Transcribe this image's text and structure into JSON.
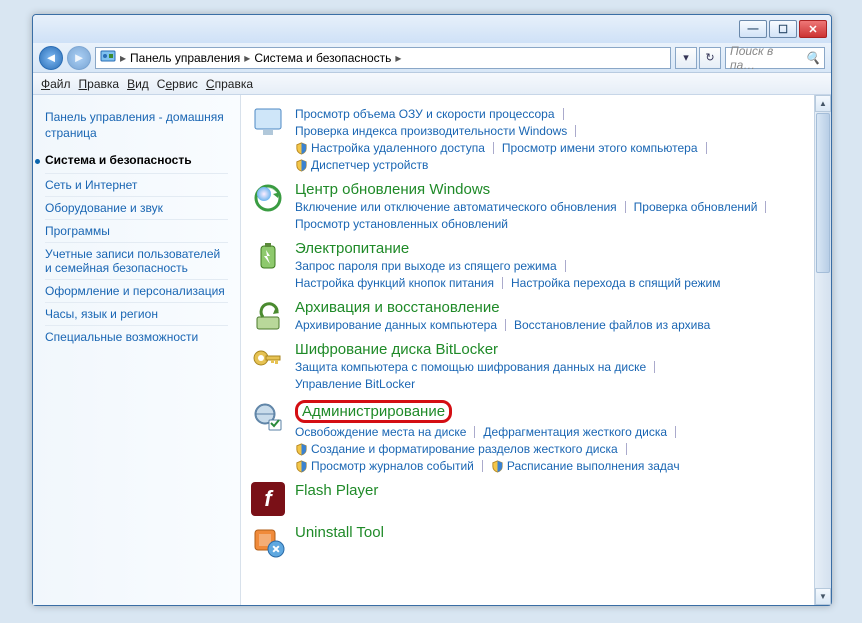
{
  "titlebar": {
    "min": "—",
    "max": "☐",
    "close": "✕"
  },
  "address": {
    "crumb1": "Панель управления",
    "crumb2": "Система и безопасность",
    "refresh_glyph": "↻"
  },
  "search": {
    "placeholder": "Поиск в па…",
    "icon": "🔍"
  },
  "menu": {
    "file": "Файл",
    "edit": "Правка",
    "view": "Вид",
    "tools": "Сервис",
    "help": "Справка"
  },
  "sidebar": {
    "home": "Панель управления - домашняя страница",
    "current": "Система и безопасность",
    "items": [
      "Сеть и Интернет",
      "Оборудование и звук",
      "Программы",
      "Учетные записи пользователей и семейная безопасность",
      "Оформление и персонализация",
      "Часы, язык и регион",
      "Специальные возможности"
    ]
  },
  "categories": {
    "system_partial": {
      "links": [
        {
          "shield": false,
          "text": "Просмотр объема ОЗУ и скорости процессора"
        },
        {
          "shield": false,
          "text": "Проверка индекса производительности Windows"
        },
        {
          "shield": true,
          "text": "Настройка удаленного доступа"
        },
        {
          "shield": false,
          "text": "Просмотр имени этого компьютера"
        },
        {
          "shield": true,
          "text": "Диспетчер устройств"
        }
      ]
    },
    "update": {
      "title": "Центр обновления Windows",
      "links": [
        {
          "shield": false,
          "text": "Включение или отключение автоматического обновления"
        },
        {
          "shield": false,
          "text": "Проверка обновлений"
        },
        {
          "shield": false,
          "text": "Просмотр установленных обновлений"
        }
      ]
    },
    "power": {
      "title": "Электропитание",
      "links": [
        {
          "shield": false,
          "text": "Запрос пароля при выходе из спящего режима"
        },
        {
          "shield": false,
          "text": "Настройка функций кнопок питания"
        },
        {
          "shield": false,
          "text": "Настройка перехода в спящий режим"
        }
      ]
    },
    "backup": {
      "title": "Архивация и восстановление",
      "links": [
        {
          "shield": false,
          "text": "Архивирование данных компьютера"
        },
        {
          "shield": false,
          "text": "Восстановление файлов из архива"
        }
      ]
    },
    "bitlocker": {
      "title": "Шифрование диска BitLocker",
      "links": [
        {
          "shield": false,
          "text": "Защита компьютера с помощью шифрования данных на диске"
        },
        {
          "shield": false,
          "text": "Управление BitLocker"
        }
      ]
    },
    "admin": {
      "title": "Администрирование",
      "links": [
        {
          "shield": false,
          "text": "Освобождение места на диске"
        },
        {
          "shield": false,
          "text": "Дефрагментация жесткого диска"
        },
        {
          "shield": true,
          "text": "Создание и форматирование разделов жесткого диска"
        },
        {
          "shield": true,
          "text": "Просмотр журналов событий"
        },
        {
          "shield": true,
          "text": "Расписание выполнения задач"
        }
      ]
    },
    "flash": {
      "title": "Flash Player"
    },
    "uninstall": {
      "title": "Uninstall Tool"
    }
  }
}
